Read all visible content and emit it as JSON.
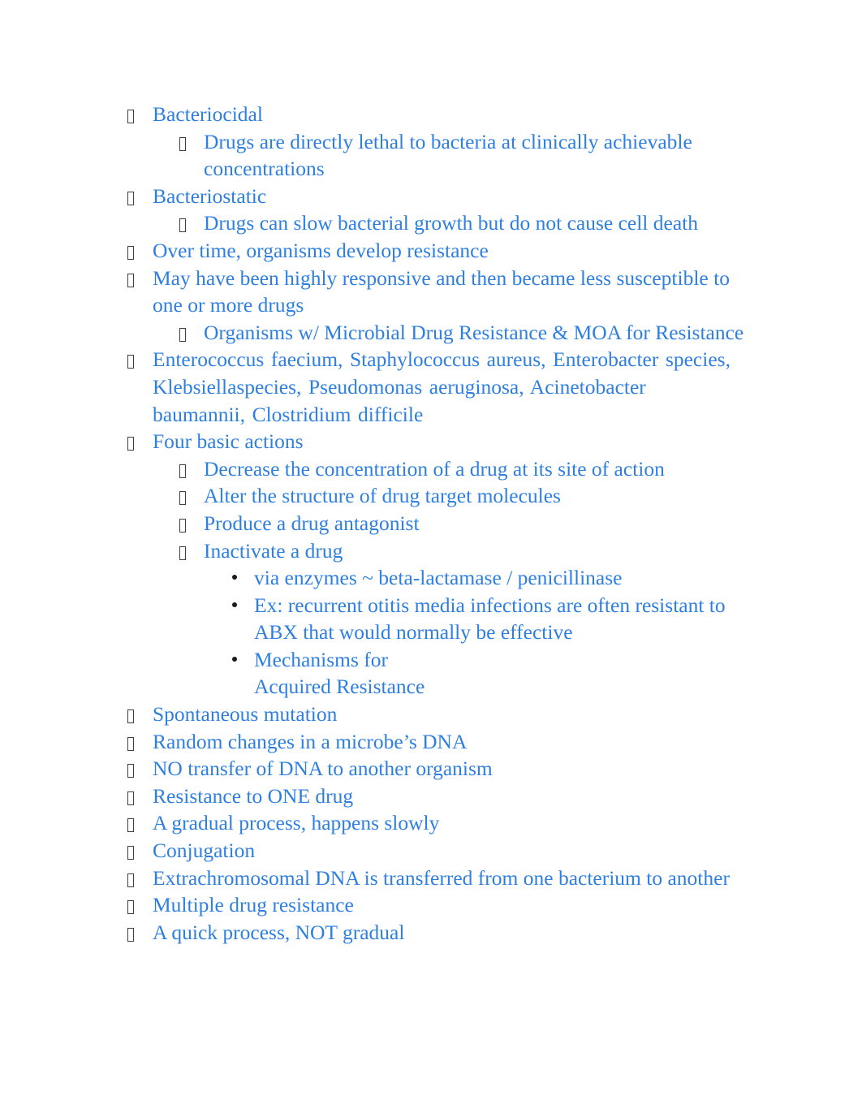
{
  "document": {
    "title": "Microbial Drug Resistance",
    "text_color": "#2E7FE0",
    "bullet_color": "#3f3f3f",
    "background_color": "#ffffff",
    "bullet_glyphs": {
      "level1": "tofu-box",
      "level2": "tofu-box",
      "level3": "round-dot"
    }
  },
  "outline": [
    {
      "level": 1,
      "text": "Bacteriocidal"
    },
    {
      "level": 2,
      "text": "Drugs are directly lethal to bacteria at clinically achievable concentrations"
    },
    {
      "level": 1,
      "text": "Bacteriostatic"
    },
    {
      "level": 2,
      "text": "Drugs can slow bacterial growth but do not cause cell death"
    },
    {
      "level": 1,
      "text": "Over time, organisms develop resistance"
    },
    {
      "level": 1,
      "text": "May have been highly responsive and then became less susceptible to one or more drugs"
    },
    {
      "level": 2,
      "text": "Organisms w/ Microbial Drug Resistance & MOA for Resistance"
    },
    {
      "level": 1,
      "text": "Enterococcus faecium, Staphylococcus aureus, Enterobacter species, Klebsiellaspecies, Pseudomonas aeruginosa, Acinetobacter baumannii, Clostridium difficile"
    },
    {
      "level": 1,
      "text": "Four basic actions"
    },
    {
      "level": 2,
      "text": "Decrease the concentration of a drug at its site of action"
    },
    {
      "level": 2,
      "text": "Alter the structure of drug target molecules"
    },
    {
      "level": 2,
      "text": "Produce a drug antagonist"
    },
    {
      "level": 2,
      "text": "Inactivate a drug"
    },
    {
      "level": 3,
      "text": "via enzymes ~ beta-lactamase / penicillinase"
    },
    {
      "level": 3,
      "text": "Ex: recurrent otitis media infections are often resistant to ABX that would normally be effective"
    },
    {
      "level": 3,
      "text": "Mechanisms for\nAcquired Resistance"
    },
    {
      "level": 1,
      "text": "Spontaneous mutation"
    },
    {
      "level": 1,
      "text": "Random changes in a microbe’s DNA"
    },
    {
      "level": 1,
      "text": "NO transfer of DNA to another organism"
    },
    {
      "level": 1,
      "text": "Resistance to ONE drug"
    },
    {
      "level": 1,
      "text": "A gradual process, happens slowly"
    },
    {
      "level": 1,
      "text": "Conjugation"
    },
    {
      "level": 1,
      "text": "Extrachromosomal DNA is transferred from one bacterium to another"
    },
    {
      "level": 1,
      "text": "Multiple drug resistance"
    },
    {
      "level": 1,
      "text": "A quick process, NOT gradual"
    }
  ]
}
